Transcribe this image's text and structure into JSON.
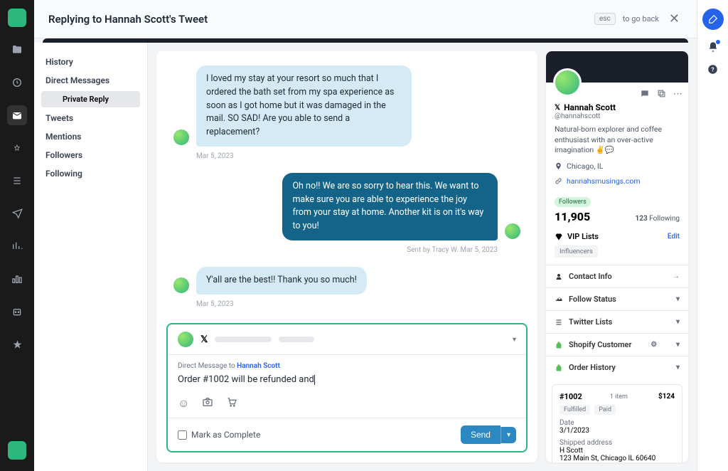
{
  "header": {
    "title": "Replying to Hannah Scott's Tweet",
    "esc": "esc",
    "go_back": "to go back"
  },
  "left_nav": {
    "history": "History",
    "direct_messages": "Direct Messages",
    "private_reply": "Private Reply",
    "tweets": "Tweets",
    "mentions": "Mentions",
    "followers": "Followers",
    "following": "Following"
  },
  "messages": [
    {
      "type": "received",
      "text": "I loved my stay at your resort so much that I ordered the bath set from my spa experience as soon as I got home but it was damaged in the mail. SO SAD! Are you able to send a replacement?",
      "meta": "Mar 5, 2023"
    },
    {
      "type": "sent",
      "text": "Oh no!! We are so sorry to hear this. We want to make sure you are able to experience the joy from your stay at home. Another kit is on it's way to you!",
      "meta": "Sent by Tracy W. Mar 5, 2023"
    },
    {
      "type": "received",
      "text": "Y'all are the best!! Thank you so much!",
      "meta": "Mar 5, 2023"
    }
  ],
  "composer": {
    "dm_prefix": "Direct Message to ",
    "dm_to": "Hannah Scott",
    "draft": "Order #1002 will be refunded and",
    "mark_complete": "Mark as Complete",
    "send": "Send"
  },
  "profile": {
    "name": "Hannah Scott",
    "handle": "@hannahscott",
    "bio": "Natural-born explorer and coffee enthusiast with an over-active imagination ✌️💬",
    "location": "Chicago, IL",
    "url": "hannahsmusings.com",
    "followers_label": "Followers",
    "followers": "11,905",
    "following": "123",
    "following_label": "Following",
    "vip_label": "VIP Lists",
    "vip_edit": "Edit",
    "vip_tag": "Influencers"
  },
  "accordion": {
    "contact": "Contact Info",
    "follow_status": "Follow Status",
    "twitter_lists": "Twitter Lists",
    "shopify_customer": "Shopify Customer",
    "order_history": "Order History"
  },
  "order": {
    "id": "#1002",
    "items": "1 item",
    "price": "$124",
    "fulfilled": "Fulfilled",
    "paid": "Paid",
    "date_label": "Date",
    "date": "3/1/2023",
    "shipped_label": "Shipped address",
    "ship_name": "H Scott",
    "ship_addr": "123 Main St, Chicago IL 60640"
  }
}
